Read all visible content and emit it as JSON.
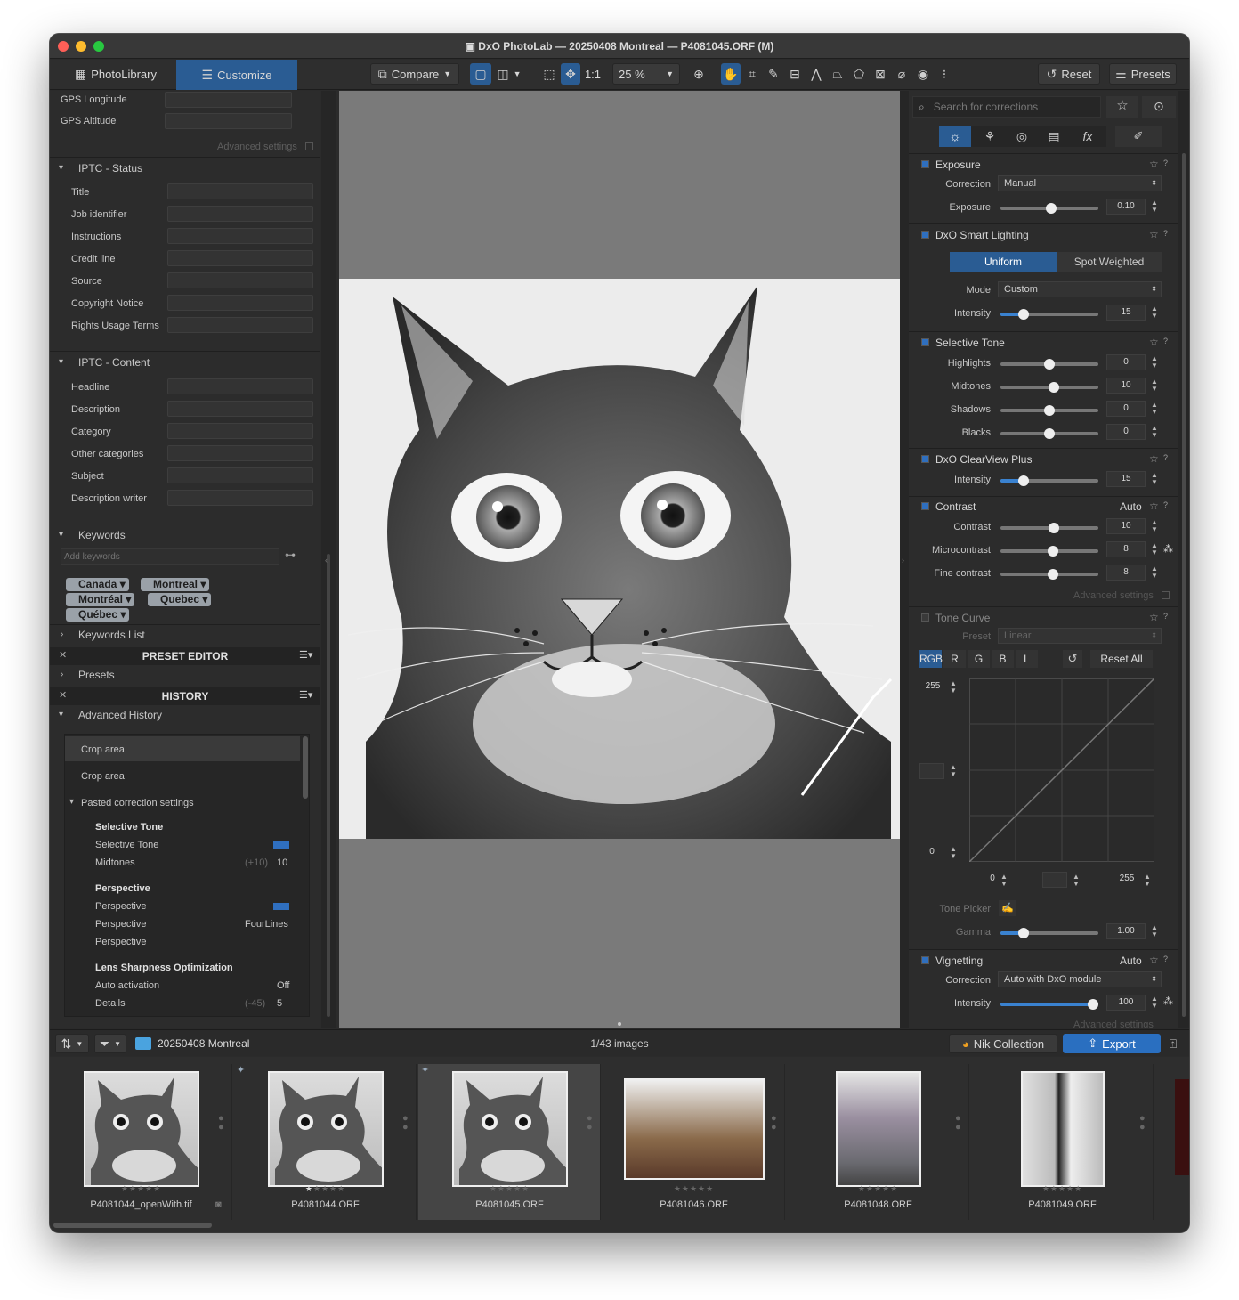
{
  "window": {
    "title": "DxO PhotoLab — 20250408 Montreal — P4081045.ORF (M)"
  },
  "toolbar": {
    "tab_library": "PhotoLibrary",
    "tab_customize": "Customize",
    "compare": "Compare",
    "one_to_one": "1:1",
    "zoom": "25 %",
    "reset": "Reset",
    "presets": "Presets"
  },
  "metadata": {
    "gps_longitude": "GPS Longitude",
    "gps_altitude": "GPS Altitude",
    "advanced_settings": "Advanced settings",
    "iptc_status": {
      "title": "IPTC - Status",
      "fields": [
        "Title",
        "Job identifier",
        "Instructions",
        "Credit line",
        "Source",
        "Copyright Notice",
        "Rights Usage Terms"
      ]
    },
    "iptc_content": {
      "title": "IPTC - Content",
      "fields": [
        "Headline",
        "Description",
        "Category",
        "Other categories",
        "Subject",
        "Description writer"
      ]
    },
    "keywords": {
      "title": "Keywords",
      "placeholder": "Add keywords",
      "tags": [
        "Canada",
        "Montreal",
        "Montréal",
        "Quebec",
        "Québec"
      ],
      "list": "Keywords List"
    }
  },
  "preset_editor": {
    "title": "PRESET EDITOR",
    "presets": "Presets"
  },
  "history": {
    "title": "HISTORY",
    "advanced": "Advanced History",
    "items": [
      "Crop area",
      "Crop area",
      "Pasted correction settings"
    ],
    "groups": [
      {
        "title": "Selective Tone",
        "rows": [
          {
            "label": "Selective Tone",
            "value": "",
            "old": ""
          },
          {
            "label": "Midtones",
            "old": "(+10)",
            "value": "10"
          }
        ]
      },
      {
        "title": "Perspective",
        "rows": [
          {
            "label": "Perspective",
            "value": "",
            "old": ""
          },
          {
            "label": "Perspective",
            "value": "FourLines",
            "old": ""
          },
          {
            "label": "Perspective",
            "value": "",
            "old": ""
          }
        ]
      },
      {
        "title": "Lens Sharpness Optimization",
        "rows": [
          {
            "label": "Auto activation",
            "value": "Off",
            "old": ""
          },
          {
            "label": "Details",
            "old": "(-45)",
            "value": "5"
          }
        ]
      }
    ]
  },
  "corrections": {
    "search_placeholder": "Search for corrections",
    "exposure": {
      "title": "Exposure",
      "correction_label": "Correction",
      "correction_value": "Manual",
      "exposure_label": "Exposure",
      "exposure_value": "0.10",
      "exposure_level": 0.52
    },
    "smart_lighting": {
      "title": "DxO Smart Lighting",
      "uniform": "Uniform",
      "spot": "Spot Weighted",
      "mode_label": "Mode",
      "mode_value": "Custom",
      "intensity_label": "Intensity",
      "intensity_value": "15",
      "intensity_level": 0.2
    },
    "selective_tone": {
      "title": "Selective Tone",
      "rows": [
        {
          "label": "Highlights",
          "value": "0",
          "level": 0.5
        },
        {
          "label": "Midtones",
          "value": "10",
          "level": 0.55
        },
        {
          "label": "Shadows",
          "value": "0",
          "level": 0.5
        },
        {
          "label": "Blacks",
          "value": "0",
          "level": 0.5
        }
      ]
    },
    "clearview": {
      "title": "DxO ClearView Plus",
      "intensity_label": "Intensity",
      "intensity_value": "15",
      "intensity_level": 0.2
    },
    "contrast": {
      "title": "Contrast",
      "auto": "Auto",
      "rows": [
        {
          "label": "Contrast",
          "value": "10",
          "level": 0.55
        },
        {
          "label": "Microcontrast",
          "value": "8",
          "level": 0.54
        },
        {
          "label": "Fine contrast",
          "value": "8",
          "level": 0.54
        }
      ],
      "advanced": "Advanced settings"
    },
    "tone_curve": {
      "title": "Tone Curve",
      "preset_label": "Preset",
      "preset_value": "Linear",
      "channels": [
        "RGB",
        "R",
        "G",
        "B",
        "L"
      ],
      "reset_all": "Reset All",
      "top": "255",
      "bottom": "0",
      "x_min": "0",
      "x_max": "255",
      "tone_picker": "Tone Picker",
      "gamma_label": "Gamma",
      "gamma_value": "1.00",
      "gamma_level": 0.2
    },
    "vignetting": {
      "title": "Vignetting",
      "auto": "Auto",
      "correction_label": "Correction",
      "correction_value": "Auto with DxO module",
      "intensity_label": "Intensity",
      "intensity_value": "100",
      "intensity_level": 1.0,
      "advanced": "Advanced settings"
    }
  },
  "bottombar": {
    "folder": "20250408 Montreal",
    "count": "1/43 images",
    "nik": "Nik Collection",
    "export": "Export"
  },
  "filmstrip": [
    {
      "name": "P4081044_openWith.tif",
      "stars": 0,
      "type": "cat"
    },
    {
      "name": "P4081044.ORF",
      "stars": 1,
      "type": "cat"
    },
    {
      "name": "P4081045.ORF",
      "stars": 0,
      "type": "cat",
      "selected": true
    },
    {
      "name": "P4081046.ORF",
      "stars": 0,
      "type": "bike"
    },
    {
      "name": "P4081048.ORF",
      "stars": 0,
      "type": "house"
    },
    {
      "name": "P4081049.ORF",
      "stars": 0,
      "type": "sign"
    }
  ],
  "colors": {
    "accent": "#2f6fbf",
    "panel": "#2c2c2c",
    "viewer": "#7a7a7a"
  }
}
